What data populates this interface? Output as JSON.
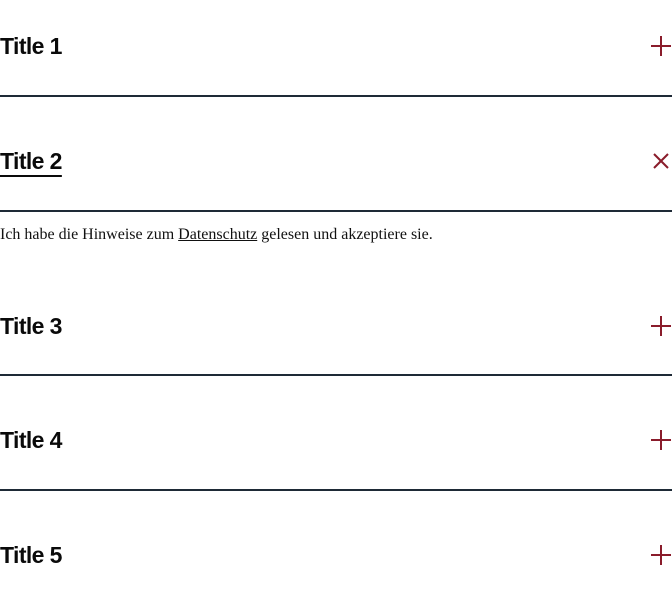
{
  "accordion": {
    "items": [
      {
        "title": "Title 1",
        "expanded": false,
        "icon": "plus-icon"
      },
      {
        "title": "Title 2",
        "expanded": true,
        "icon": "close-icon",
        "content": {
          "before": "Ich habe die Hinweise zum ",
          "link": "Datenschutz",
          "after": " gelesen und akzeptiere sie."
        }
      },
      {
        "title": "Title 3",
        "expanded": false,
        "icon": "plus-icon"
      },
      {
        "title": "Title 4",
        "expanded": false,
        "icon": "plus-icon"
      },
      {
        "title": "Title 5",
        "expanded": false,
        "icon": "plus-icon"
      }
    ]
  },
  "colors": {
    "accent": "#8a1c2b",
    "divider": "#1e2a36",
    "text": "#0a0a0a"
  }
}
